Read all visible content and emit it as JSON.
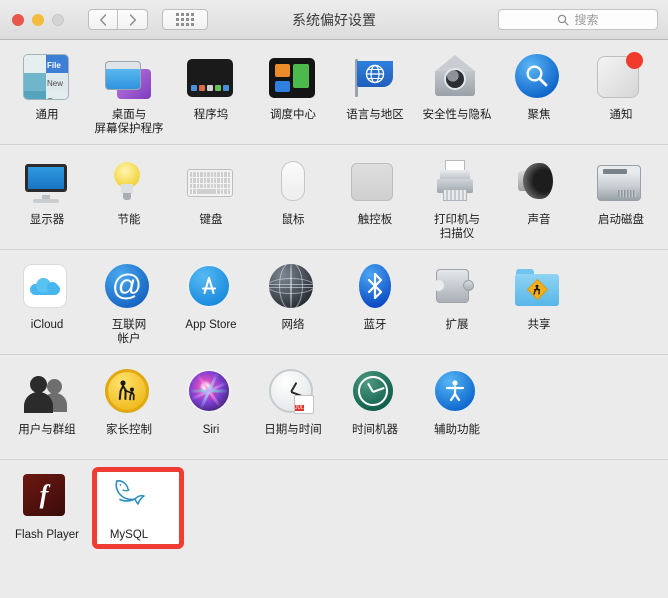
{
  "window": {
    "title": "系统偏好设置",
    "traffic_lights": [
      "close",
      "minimize",
      "zoom"
    ],
    "nav": {
      "back": "‹",
      "forward": "›"
    },
    "grid_button": "show-all-grid",
    "search": {
      "placeholder": "搜索",
      "value": ""
    }
  },
  "accent_colors": {
    "highlight_box": "#ef3d33",
    "window_background": "#ebebeb",
    "separator": "#d2d2d2",
    "title_text": "#3b3b3b"
  },
  "rows": [
    {
      "name": "personal",
      "items": [
        {
          "label": "通用",
          "icon": "general-icon"
        },
        {
          "label": "桌面与\n屏幕保护程序",
          "icon": "desktop-screensaver-icon"
        },
        {
          "label": "程序坞",
          "icon": "dock-icon"
        },
        {
          "label": "调度中心",
          "icon": "mission-control-icon"
        },
        {
          "label": "语言与地区",
          "icon": "language-region-icon"
        },
        {
          "label": "安全性与隐私",
          "icon": "security-privacy-icon"
        },
        {
          "label": "聚焦",
          "icon": "spotlight-icon"
        },
        {
          "label": "通知",
          "icon": "notifications-icon"
        }
      ]
    },
    {
      "name": "hardware",
      "items": [
        {
          "label": "显示器",
          "icon": "displays-icon"
        },
        {
          "label": "节能",
          "icon": "energy-saver-icon"
        },
        {
          "label": "键盘",
          "icon": "keyboard-icon"
        },
        {
          "label": "鼠标",
          "icon": "mouse-icon"
        },
        {
          "label": "触控板",
          "icon": "trackpad-icon"
        },
        {
          "label": "打印机与\n扫描仪",
          "icon": "printers-scanners-icon"
        },
        {
          "label": "声音",
          "icon": "sound-icon"
        },
        {
          "label": "启动磁盘",
          "icon": "startup-disk-icon"
        }
      ]
    },
    {
      "name": "internet-wireless",
      "items": [
        {
          "label": "iCloud",
          "icon": "icloud-icon"
        },
        {
          "label": "互联网\n帐户",
          "icon": "internet-accounts-icon"
        },
        {
          "label": "App Store",
          "icon": "app-store-icon"
        },
        {
          "label": "网络",
          "icon": "network-icon"
        },
        {
          "label": "蓝牙",
          "icon": "bluetooth-icon"
        },
        {
          "label": "扩展",
          "icon": "extensions-icon"
        },
        {
          "label": "共享",
          "icon": "sharing-icon"
        }
      ]
    },
    {
      "name": "system",
      "items": [
        {
          "label": "用户与群组",
          "icon": "users-groups-icon"
        },
        {
          "label": "家长控制",
          "icon": "parental-controls-icon"
        },
        {
          "label": "Siri",
          "icon": "siri-icon"
        },
        {
          "label": "日期与时间",
          "icon": "date-time-icon",
          "badge_month": "JUL",
          "badge_day": "18"
        },
        {
          "label": "时间机器",
          "icon": "time-machine-icon"
        },
        {
          "label": "辅助功能",
          "icon": "accessibility-icon"
        }
      ]
    },
    {
      "name": "other",
      "items": [
        {
          "label": "Flash Player",
          "icon": "flash-player-icon"
        },
        {
          "label": "MySQL",
          "icon": "mysql-dolphin-icon",
          "highlighted": true
        }
      ]
    }
  ]
}
